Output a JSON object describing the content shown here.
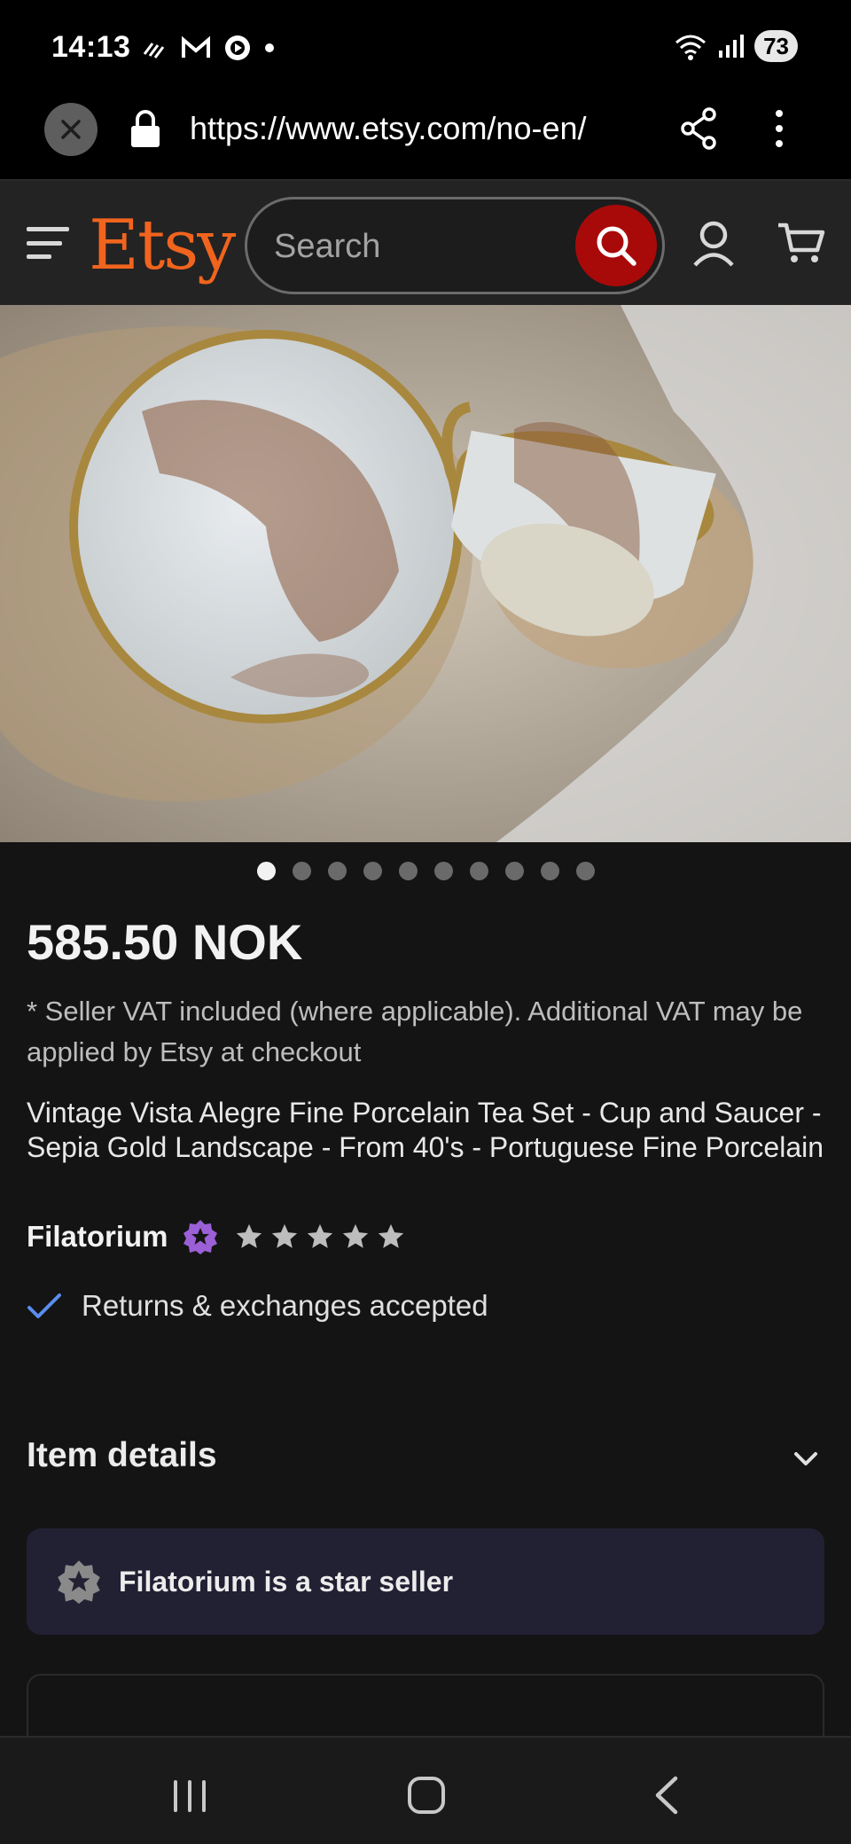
{
  "status_bar": {
    "time": "14:13",
    "battery": "73",
    "icons_left": [
      "wifi-calling-icon",
      "gmail-icon",
      "media-play-icon",
      "notification-dot-icon"
    ],
    "icons_right": [
      "wifi-icon",
      "signal-icon",
      "battery-icon"
    ]
  },
  "browser": {
    "url": "https://www.etsy.com/no-en/",
    "icons": [
      "close-icon",
      "lock-icon",
      "share-icon",
      "more-vertical-icon"
    ]
  },
  "header": {
    "logo": "Etsy",
    "search_placeholder": "Search",
    "icons": [
      "menu-icon",
      "search-icon",
      "user-icon",
      "cart-icon"
    ],
    "accent_color": "#f1641e",
    "search_button_color": "#a80a0a"
  },
  "carousel": {
    "total": 10,
    "active_index": 0
  },
  "product": {
    "price": "585.50 NOK",
    "vat_note": "* Seller VAT included (where applicable). Additional VAT may be applied by Etsy at checkout",
    "title": "Vintage Vista Alegre Fine Porcelain Tea Set - Cup and Saucer - Sepia Gold Landscape - From 40's - Portuguese Fine Porcelain",
    "shop_name": "Filatorium",
    "rating_stars": 5,
    "returns": "Returns & exchanges accepted"
  },
  "sections": {
    "item_details": "Item details",
    "star_seller": "Filatorium is a star seller"
  },
  "nav_bar": {
    "icons": [
      "recents-icon",
      "home-icon",
      "back-icon"
    ]
  }
}
